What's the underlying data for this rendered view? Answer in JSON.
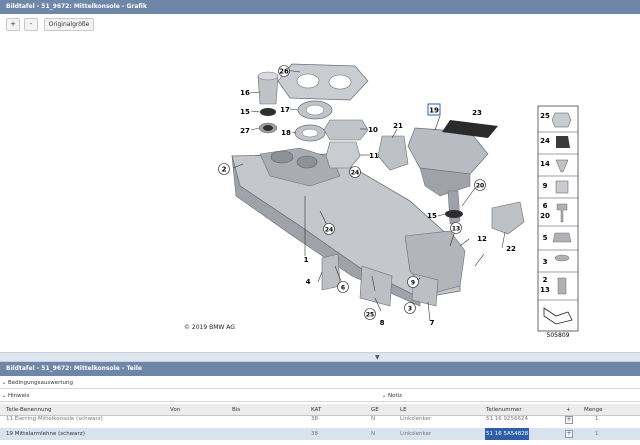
{
  "window": {
    "title_graphic": "Bildtafel - 51_9672: Mittelkonsole - Grafik",
    "title_parts": "Bildtafel - 51_9672: Mittelkonsole - Teile"
  },
  "toolbar": {
    "zoom_in": "+",
    "zoom_out": "-",
    "original_size": "Originalgröße"
  },
  "diagram": {
    "copyright": "© 2019 BMW AG",
    "figure_id": "505809",
    "callouts": [
      "26",
      "16",
      "15",
      "17",
      "27",
      "18",
      "10",
      "19",
      "23",
      "21",
      "11",
      "2",
      "24",
      "20",
      "15",
      "1",
      "24",
      "13",
      "12",
      "4",
      "6",
      "8",
      "9",
      "25",
      "3",
      "7",
      "22"
    ],
    "legend_parts": [
      "25",
      "24",
      "14",
      "9",
      "6",
      "20",
      "5",
      "3",
      "2",
      "13"
    ]
  },
  "splitter": {
    "handle": "▼"
  },
  "sections": {
    "bedingung": "Bedingungsauswertung",
    "hinweis": "Hinweis",
    "notiz": "Notiz"
  },
  "table": {
    "headers": [
      "Teile-Benennung",
      "Von",
      "Bis",
      "KAT",
      "GE",
      "LE",
      "Teilenummer",
      "+",
      "Menge"
    ],
    "rows": [
      {
        "name": "11 Eierring Mittelkonsole (schwarz)",
        "kat": "38",
        "ge": "N",
        "le": "Linkslenker",
        "nr": "51 16 9256624",
        "menge": "1"
      },
      {
        "name": "19 Mittelarmlehne (schwarz)",
        "kat": "38",
        "ge": "N",
        "le": "Linkslenker",
        "nr": "51 16 5A54828",
        "menge": "1"
      }
    ]
  },
  "colors": {
    "titlebar": "#6e87a8",
    "selection": "#2f5ea8",
    "row_highlight": "#d9e2ef"
  }
}
